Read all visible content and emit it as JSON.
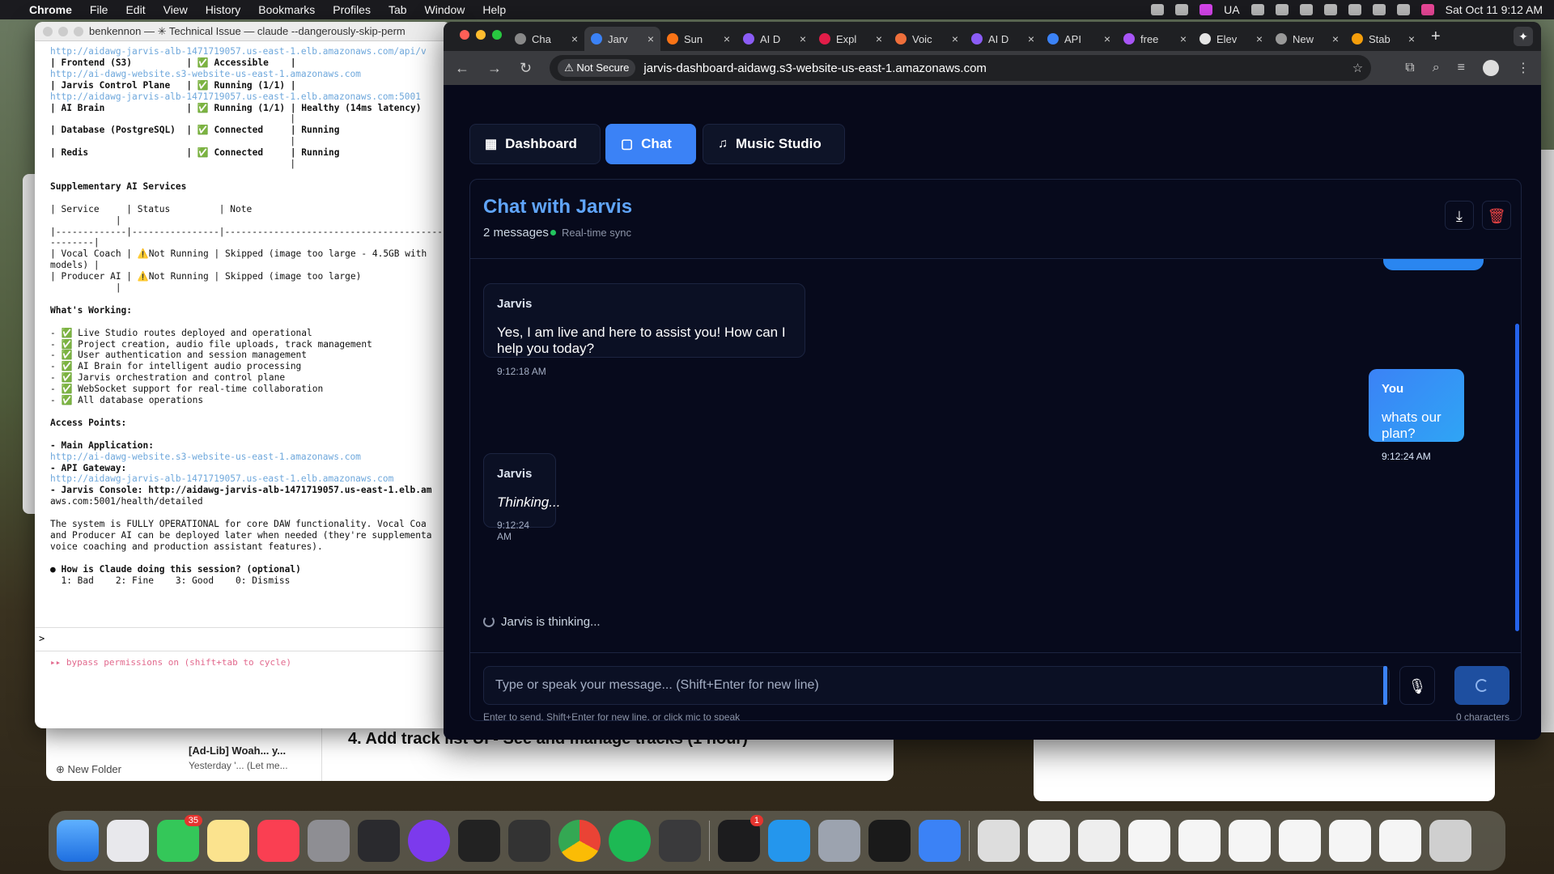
{
  "menubar": {
    "apple": "",
    "app": "Chrome",
    "items": [
      "File",
      "Edit",
      "View",
      "History",
      "Bookmarks",
      "Profiles",
      "Tab",
      "Window",
      "Help"
    ],
    "input_source": "UA",
    "clock": "Sat Oct 11  9:12 AM"
  },
  "terminal": {
    "title": "benkennon — ✳ Technical Issue — claude --dangerously-skip-perm",
    "lines": [
      {
        "t": "http://aidawg-jarvis-alb-1471719057.us-east-1.elb.amazonaws.com/api/v",
        "c": "link"
      },
      {
        "t": "| Frontend (S3)          | ✅ Accessible    |",
        "c": "b"
      },
      {
        "t": "http://ai-dawg-website.s3-website-us-east-1.amazonaws.com",
        "c": "link"
      },
      {
        "t": "| Jarvis Control Plane   | ✅ Running (1/1) |",
        "c": "b"
      },
      {
        "t": "http://aidawg-jarvis-alb-1471719057.us-east-1.elb.amazonaws.com:5001",
        "c": "link"
      },
      {
        "t": "| AI Brain               | ✅ Running (1/1) | Healthy (14ms latency)",
        "c": "b"
      },
      {
        "t": "                                            |",
        "c": ""
      },
      {
        "t": "| Database (PostgreSQL)  | ✅ Connected     | Running",
        "c": "b"
      },
      {
        "t": "                                            |",
        "c": ""
      },
      {
        "t": "| Redis                  | ✅ Connected     | Running",
        "c": "b"
      },
      {
        "t": "                                            |",
        "c": ""
      },
      {
        "t": "",
        "c": ""
      },
      {
        "t": "Supplementary AI Services",
        "c": "b"
      },
      {
        "t": "",
        "c": ""
      },
      {
        "t": "| Service     | Status         | Note",
        "c": ""
      },
      {
        "t": "            |",
        "c": ""
      },
      {
        "t": "|-------------|----------------|------------------------------------------",
        "c": ""
      },
      {
        "t": "--------|",
        "c": ""
      },
      {
        "t": "| Vocal Coach | ⚠️Not Running | Skipped (image too large - 4.5GB with",
        "c": ""
      },
      {
        "t": "models) |",
        "c": ""
      },
      {
        "t": "| Producer AI | ⚠️Not Running | Skipped (image too large)",
        "c": ""
      },
      {
        "t": "            |",
        "c": ""
      },
      {
        "t": "",
        "c": ""
      },
      {
        "t": "What's Working:",
        "c": "b"
      },
      {
        "t": "",
        "c": ""
      },
      {
        "t": "- ✅ Live Studio routes deployed and operational",
        "c": ""
      },
      {
        "t": "- ✅ Project creation, audio file uploads, track management",
        "c": ""
      },
      {
        "t": "- ✅ User authentication and session management",
        "c": ""
      },
      {
        "t": "- ✅ AI Brain for intelligent audio processing",
        "c": ""
      },
      {
        "t": "- ✅ Jarvis orchestration and control plane",
        "c": ""
      },
      {
        "t": "- ✅ WebSocket support for real-time collaboration",
        "c": ""
      },
      {
        "t": "- ✅ All database operations",
        "c": ""
      },
      {
        "t": "",
        "c": ""
      },
      {
        "t": "Access Points:",
        "c": "b"
      },
      {
        "t": "",
        "c": ""
      },
      {
        "t": "- Main Application:",
        "c": "b"
      },
      {
        "t": "http://ai-dawg-website.s3-website-us-east-1.amazonaws.com",
        "c": "link"
      },
      {
        "t": "- API Gateway:",
        "c": "b"
      },
      {
        "t": "http://aidawg-jarvis-alb-1471719057.us-east-1.elb.amazonaws.com",
        "c": "link"
      },
      {
        "t": "- Jarvis Console: http://aidawg-jarvis-alb-1471719057.us-east-1.elb.am",
        "c": "b"
      },
      {
        "t": "aws.com:5001/health/detailed",
        "c": ""
      },
      {
        "t": "",
        "c": ""
      },
      {
        "t": "The system is FULLY OPERATIONAL for core DAW functionality. Vocal Coa",
        "c": ""
      },
      {
        "t": "and Producer AI can be deployed later when needed (they're supplementa",
        "c": ""
      },
      {
        "t": "voice coaching and production assistant features).",
        "c": ""
      },
      {
        "t": "",
        "c": ""
      },
      {
        "t": "● How is Claude doing this session? (optional)",
        "c": "b"
      },
      {
        "t": "  1: Bad    2: Fine    3: Good    0: Dismiss",
        "c": ""
      }
    ],
    "prompt": ">",
    "bypass": "▸▸ bypass permissions on (shift+tab to cycle)"
  },
  "notes": {
    "new_folder": "New Folder",
    "note_title": "[Ad-Lib] Woah... y...",
    "note_meta": "Yesterday  '... (Let me...",
    "heading": "4. Add track list UI - See and manage tracks (1 hour)"
  },
  "chrome": {
    "tabs": [
      {
        "label": "Cha",
        "color": "#888"
      },
      {
        "label": "Jarv",
        "color": "#3b82f6",
        "active": true
      },
      {
        "label": "Sun",
        "color": "#f97316"
      },
      {
        "label": "AI D",
        "color": "#8b5cf6"
      },
      {
        "label": "Expl",
        "color": "#e11d48"
      },
      {
        "label": "Voic",
        "color": "#ef6f3b"
      },
      {
        "label": "AI D",
        "color": "#8b5cf6"
      },
      {
        "label": "API",
        "color": "#3b82f6"
      },
      {
        "label": "free",
        "color": "#a855f7"
      },
      {
        "label": "Elev",
        "color": "#e5e5e5"
      },
      {
        "label": "New",
        "color": "#999"
      },
      {
        "label": "Stab",
        "color": "#f59e0b"
      }
    ],
    "not_secure": "⚠ Not Secure",
    "url": "jarvis-dashboard-aidawg.s3-website-us-east-1.amazonaws.com"
  },
  "app": {
    "nav": [
      {
        "label": "Dashboard",
        "icon": "▦"
      },
      {
        "label": "Chat",
        "icon": "▢"
      },
      {
        "label": "Music Studio",
        "icon": "♫"
      }
    ],
    "chat_title": "Chat with Jarvis",
    "message_count": "2 messages",
    "sync": "Real-time sync",
    "messages": [
      {
        "sender": "Jarvis",
        "text": "Yes, I am live and here to assist you! How can I help you today?",
        "time": "9:12:18 AM"
      },
      {
        "sender": "You",
        "text": "whats our plan?",
        "time": "9:12:24 AM"
      },
      {
        "sender": "Jarvis",
        "text": "Thinking...",
        "time": "9:12:24 AM"
      }
    ],
    "thinking": "Jarvis is thinking...",
    "input_placeholder": "Type or speak your message... (Shift+Enter for new line)",
    "hint": "Enter to send, Shift+Enter for new line, or click mic to speak",
    "char_count": "0 characters"
  },
  "dock": {
    "messages_badge": "35",
    "terminal_badge": "1"
  }
}
